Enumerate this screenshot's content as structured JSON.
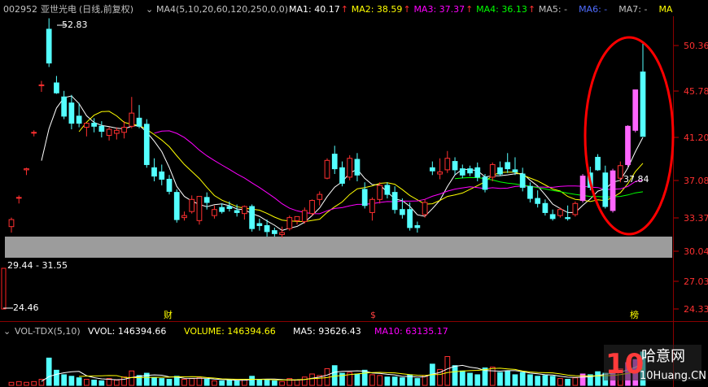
{
  "header": {
    "code": "002952",
    "name": "亚世光电",
    "mode": "(日线,前复权)",
    "dropdown_icon": "chevron-down-icon",
    "ma_group": "MA4(5,10,20,60,120,250,0,0)",
    "ma_items": [
      {
        "label": "MA1:",
        "value": "40.17",
        "color": "#ffffff"
      },
      {
        "label": "MA2:",
        "value": "38.59",
        "color": "#ffff00"
      },
      {
        "label": "MA3:",
        "value": "37.37",
        "color": "#ff00ff"
      },
      {
        "label": "MA4:",
        "value": "36.13",
        "color": "#00ff00"
      },
      {
        "label": "MA5:",
        "value": "-",
        "color": "#c0c0c0"
      },
      {
        "label": "MA6:",
        "value": "-",
        "color": "#4f6cff"
      },
      {
        "label": "MA7:",
        "value": "-",
        "color": "#c0c0c0"
      },
      {
        "label": "MA",
        "value": "",
        "color": "#ffff00"
      }
    ]
  },
  "price_axis": [
    "50.36",
    "45.78",
    "41.20",
    "37.08",
    "33.37",
    "30.04",
    "27.03",
    "24.33"
  ],
  "annotations": {
    "high": "52.83",
    "low": "24.46",
    "range_label": "29.44 - 31.55",
    "cursor_price": "37.84",
    "marker_1": "财",
    "marker_2": "$",
    "marker_3": "榜"
  },
  "volume_header": {
    "name": "VOL-TDX(5,10)",
    "vvol": "VVOL: 146394.66",
    "volume": "VOLUME: 146394.66",
    "ma5": "MA5: 93626.43",
    "ma10": "MA10: 63135.17"
  },
  "watermark": {
    "left": "10",
    "mid": "哈意网",
    "bottom": "10Huang.CN"
  },
  "chart_data": {
    "type": "candlestick",
    "ylim": [
      23.5,
      53.5
    ],
    "up_color": "#ff3030",
    "down_color": "#54ffff",
    "limit_up_color": "#ff66ff",
    "candles": [
      {
        "o": 32.5,
        "h": 33.4,
        "l": 31.9,
        "c": 33.2
      },
      {
        "o": 35.4,
        "h": 35.6,
        "l": 34.8,
        "c": 35.4
      },
      {
        "o": 38.1,
        "h": 38.3,
        "l": 37.6,
        "c": 38.2
      },
      {
        "o": 41.7,
        "h": 41.9,
        "l": 41.3,
        "c": 41.7
      },
      {
        "o": 46.4,
        "h": 46.8,
        "l": 45.7,
        "c": 46.4
      },
      {
        "o": 52.0,
        "h": 53.1,
        "l": 48.2,
        "c": 48.6
      },
      {
        "o": 46.6,
        "h": 47.3,
        "l": 45.5,
        "c": 45.6
      },
      {
        "o": 45.2,
        "h": 45.8,
        "l": 43.0,
        "c": 43.3
      },
      {
        "o": 44.6,
        "h": 45.4,
        "l": 42.0,
        "c": 42.6
      },
      {
        "o": 43.3,
        "h": 44.6,
        "l": 42.2,
        "c": 42.6
      },
      {
        "o": 42.2,
        "h": 42.6,
        "l": 41.3,
        "c": 42.6
      },
      {
        "o": 42.6,
        "h": 43.1,
        "l": 41.7,
        "c": 42.3
      },
      {
        "o": 42.3,
        "h": 42.8,
        "l": 41.2,
        "c": 41.8
      },
      {
        "o": 41.4,
        "h": 42.2,
        "l": 40.9,
        "c": 42.0
      },
      {
        "o": 41.6,
        "h": 42.2,
        "l": 41.0,
        "c": 41.9
      },
      {
        "o": 41.7,
        "h": 42.8,
        "l": 41.1,
        "c": 42.2
      },
      {
        "o": 42.3,
        "h": 45.2,
        "l": 42.1,
        "c": 43.6
      },
      {
        "o": 43.1,
        "h": 44.4,
        "l": 42.1,
        "c": 42.3
      },
      {
        "o": 42.5,
        "h": 43.0,
        "l": 38.3,
        "c": 38.6
      },
      {
        "o": 38.3,
        "h": 39.2,
        "l": 37.0,
        "c": 37.5
      },
      {
        "o": 37.9,
        "h": 38.6,
        "l": 36.6,
        "c": 37.2
      },
      {
        "o": 37.2,
        "h": 37.6,
        "l": 35.7,
        "c": 36.0
      },
      {
        "o": 35.9,
        "h": 36.2,
        "l": 32.9,
        "c": 33.2
      },
      {
        "o": 33.4,
        "h": 34.0,
        "l": 33.1,
        "c": 33.6
      },
      {
        "o": 34.0,
        "h": 35.6,
        "l": 33.8,
        "c": 35.2
      },
      {
        "o": 33.1,
        "h": 35.5,
        "l": 32.7,
        "c": 35.5
      },
      {
        "o": 35.4,
        "h": 35.9,
        "l": 34.2,
        "c": 34.9
      },
      {
        "o": 33.6,
        "h": 34.6,
        "l": 33.3,
        "c": 34.2
      },
      {
        "o": 34.4,
        "h": 34.8,
        "l": 33.8,
        "c": 34.0
      },
      {
        "o": 34.5,
        "h": 35.0,
        "l": 34.0,
        "c": 34.3
      },
      {
        "o": 34.1,
        "h": 34.7,
        "l": 33.5,
        "c": 33.9
      },
      {
        "o": 33.8,
        "h": 34.6,
        "l": 33.2,
        "c": 34.5
      },
      {
        "o": 34.5,
        "h": 34.7,
        "l": 32.0,
        "c": 32.3
      },
      {
        "o": 32.8,
        "h": 33.3,
        "l": 32.1,
        "c": 32.6
      },
      {
        "o": 32.6,
        "h": 33.2,
        "l": 31.5,
        "c": 32.0
      },
      {
        "o": 32.1,
        "h": 32.4,
        "l": 31.5,
        "c": 31.8
      },
      {
        "o": 31.7,
        "h": 32.5,
        "l": 31.4,
        "c": 31.9
      },
      {
        "o": 32.3,
        "h": 33.6,
        "l": 32.1,
        "c": 33.4
      },
      {
        "o": 33.1,
        "h": 33.5,
        "l": 32.7,
        "c": 33.5
      },
      {
        "o": 33.0,
        "h": 34.4,
        "l": 32.8,
        "c": 34.1
      },
      {
        "o": 33.8,
        "h": 35.2,
        "l": 33.6,
        "c": 35.1
      },
      {
        "o": 35.2,
        "h": 36.0,
        "l": 34.6,
        "c": 35.7
      },
      {
        "o": 37.3,
        "h": 39.2,
        "l": 37.2,
        "c": 39.0
      },
      {
        "o": 39.6,
        "h": 40.4,
        "l": 37.7,
        "c": 38.2
      },
      {
        "o": 38.3,
        "h": 38.9,
        "l": 36.5,
        "c": 36.8
      },
      {
        "o": 37.4,
        "h": 39.5,
        "l": 37.1,
        "c": 39.2
      },
      {
        "o": 39.1,
        "h": 39.7,
        "l": 37.0,
        "c": 37.6
      },
      {
        "o": 36.2,
        "h": 36.9,
        "l": 34.3,
        "c": 34.6
      },
      {
        "o": 33.9,
        "h": 35.4,
        "l": 33.1,
        "c": 35.2
      },
      {
        "o": 35.2,
        "h": 36.9,
        "l": 34.8,
        "c": 36.6
      },
      {
        "o": 36.6,
        "h": 36.9,
        "l": 35.3,
        "c": 35.7
      },
      {
        "o": 35.9,
        "h": 36.5,
        "l": 33.8,
        "c": 34.2
      },
      {
        "o": 34.2,
        "h": 35.3,
        "l": 33.3,
        "c": 33.7
      },
      {
        "o": 34.2,
        "h": 34.9,
        "l": 32.1,
        "c": 32.4
      },
      {
        "o": 32.6,
        "h": 33.0,
        "l": 31.9,
        "c": 32.4
      },
      {
        "o": 33.7,
        "h": 35.2,
        "l": 33.4,
        "c": 34.9
      },
      {
        "o": 38.3,
        "h": 38.9,
        "l": 37.6,
        "c": 38.0
      },
      {
        "o": 37.7,
        "h": 39.2,
        "l": 37.2,
        "c": 37.9
      },
      {
        "o": 38.1,
        "h": 39.9,
        "l": 37.8,
        "c": 39.2
      },
      {
        "o": 38.9,
        "h": 39.3,
        "l": 37.6,
        "c": 38.1
      },
      {
        "o": 38.2,
        "h": 38.6,
        "l": 37.3,
        "c": 37.6
      },
      {
        "o": 38.2,
        "h": 38.5,
        "l": 37.5,
        "c": 37.8
      },
      {
        "o": 38.3,
        "h": 38.8,
        "l": 37.0,
        "c": 37.4
      },
      {
        "o": 37.4,
        "h": 37.7,
        "l": 35.9,
        "c": 36.2
      },
      {
        "o": 37.4,
        "h": 38.8,
        "l": 37.0,
        "c": 38.6
      },
      {
        "o": 38.3,
        "h": 38.9,
        "l": 37.5,
        "c": 37.7
      },
      {
        "o": 38.8,
        "h": 39.7,
        "l": 37.8,
        "c": 38.2
      },
      {
        "o": 38.1,
        "h": 39.3,
        "l": 37.6,
        "c": 37.9
      },
      {
        "o": 37.7,
        "h": 38.3,
        "l": 36.0,
        "c": 36.4
      },
      {
        "o": 36.5,
        "h": 36.9,
        "l": 34.9,
        "c": 35.3
      },
      {
        "o": 35.3,
        "h": 36.1,
        "l": 34.4,
        "c": 34.8
      },
      {
        "o": 34.8,
        "h": 35.2,
        "l": 33.6,
        "c": 33.9
      },
      {
        "o": 33.7,
        "h": 34.2,
        "l": 33.1,
        "c": 33.3
      },
      {
        "o": 33.6,
        "h": 34.4,
        "l": 33.4,
        "c": 34.2
      },
      {
        "o": 33.4,
        "h": 34.6,
        "l": 33.1,
        "c": 33.3
      },
      {
        "o": 33.7,
        "h": 35.0,
        "l": 33.5,
        "c": 34.8
      },
      {
        "o": 35.1,
        "h": 37.7,
        "l": 34.9,
        "c": 37.5,
        "lu": true
      },
      {
        "o": 37.8,
        "h": 38.4,
        "l": 36.1,
        "c": 36.4
      },
      {
        "o": 39.3,
        "h": 39.6,
        "l": 38.0,
        "c": 38.1
      },
      {
        "o": 37.8,
        "h": 38.5,
        "l": 34.3,
        "c": 34.5
      },
      {
        "o": 34.1,
        "h": 38.2,
        "l": 33.9,
        "c": 38.0,
        "lu": true
      },
      {
        "o": 37.3,
        "h": 38.9,
        "l": 36.9,
        "c": 38.5
      },
      {
        "o": 38.6,
        "h": 42.4,
        "l": 38.4,
        "c": 42.3,
        "lu": true
      },
      {
        "o": 41.9,
        "h": 45.9,
        "l": 41.7,
        "c": 45.9,
        "lu": true
      },
      {
        "o": 47.7,
        "h": 50.6,
        "l": 45.6,
        "c": 41.3
      }
    ],
    "volume": [
      4,
      5,
      4,
      5,
      8,
      36,
      20,
      14,
      12,
      10,
      8,
      7,
      6,
      9,
      7,
      11,
      19,
      13,
      16,
      10,
      9,
      8,
      12,
      8,
      9,
      10,
      8,
      6,
      6,
      7,
      6,
      8,
      12,
      7,
      8,
      6,
      5,
      9,
      7,
      11,
      15,
      13,
      22,
      26,
      16,
      17,
      15,
      20,
      14,
      13,
      11,
      11,
      10,
      14,
      9,
      13,
      28,
      21,
      38,
      26,
      19,
      16,
      14,
      23,
      24,
      17,
      19,
      14,
      17,
      14,
      12,
      13,
      12,
      9,
      8,
      10,
      15,
      14,
      18,
      16,
      17,
      22,
      30,
      34,
      44
    ],
    "vol_ylim": [
      0,
      60
    ]
  }
}
